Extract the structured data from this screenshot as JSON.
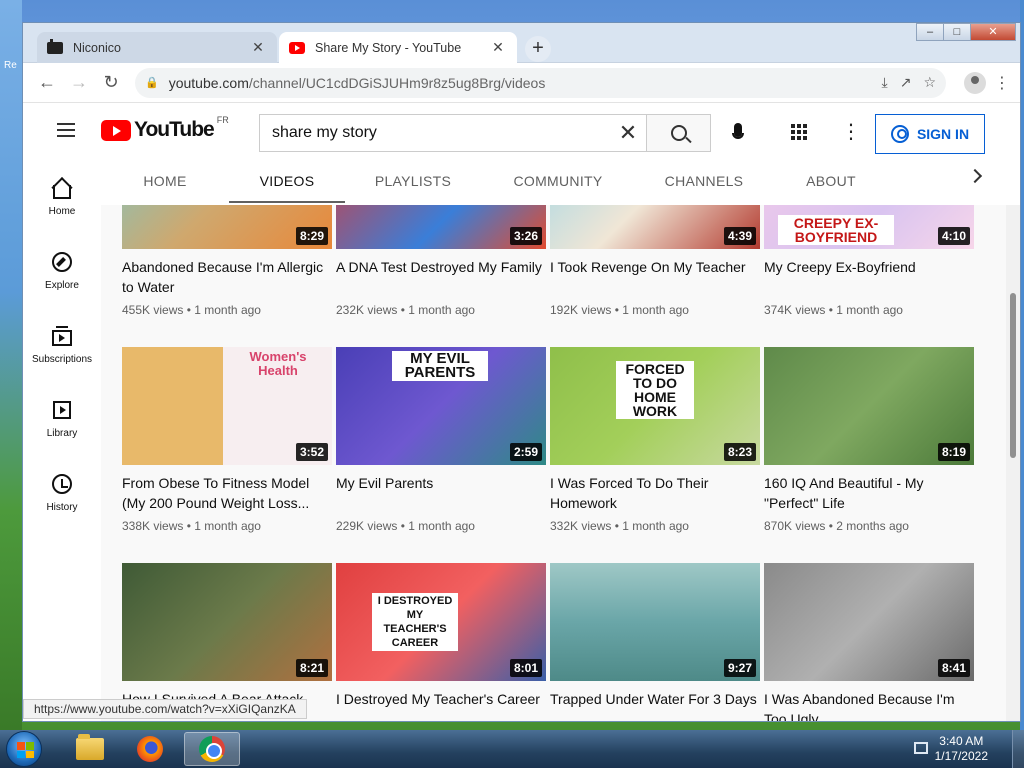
{
  "desktop": {
    "left_label": "Re"
  },
  "browser": {
    "tabs": [
      {
        "title": "Niconico",
        "close": "✕"
      },
      {
        "title": "Share My Story - YouTube",
        "close": "✕"
      }
    ],
    "new_tab": "+",
    "window_buttons": {
      "minimize": "–",
      "maximize": "□",
      "close": "✕"
    },
    "address": {
      "host": "youtube.com",
      "path": "/channel/UC1cdDGiSJUHm9r8z5ug8Brg/videos"
    },
    "status_url": "https://www.youtube.com/watch?v=xXiGIQanzKA"
  },
  "youtube": {
    "logo_text": "YouTube",
    "country_code": "FR",
    "search_value": "share my story",
    "sign_in": "SIGN IN",
    "guide": [
      {
        "label": "Home",
        "icon": "home-icon"
      },
      {
        "label": "Explore",
        "icon": "compass-icon"
      },
      {
        "label": "Subscriptions",
        "icon": "subscriptions-icon"
      },
      {
        "label": "Library",
        "icon": "library-icon"
      },
      {
        "label": "History",
        "icon": "history-icon"
      }
    ],
    "channel_tabs": [
      "HOME",
      "VIDEOS",
      "PLAYLISTS",
      "COMMUNITY",
      "CHANNELS",
      "ABOUT"
    ],
    "active_tab": "VIDEOS",
    "videos": [
      {
        "title": "Abandoned Because I'm Allergic to Water",
        "views": "455K views",
        "age": "1 month ago",
        "duration": "8:29"
      },
      {
        "title": "A DNA Test Destroyed My Family",
        "views": "232K views",
        "age": "1 month ago",
        "duration": "3:26"
      },
      {
        "title": "I Took Revenge On My Teacher",
        "views": "192K views",
        "age": "1 month ago",
        "duration": "4:39"
      },
      {
        "title": "My Creepy Ex-Boyfriend",
        "views": "374K views",
        "age": "1 month ago",
        "duration": "4:10",
        "thumb_text": "CREEPY EX-BOYFRIEND"
      },
      {
        "title": "From Obese To Fitness Model (My 200 Pound Weight Loss...",
        "views": "338K views",
        "age": "1 month ago",
        "duration": "3:52",
        "thumb_text": "Women's Health"
      },
      {
        "title": "My Evil Parents",
        "views": "229K views",
        "age": "1 month ago",
        "duration": "2:59",
        "thumb_text": "MY EVIL PARENTS"
      },
      {
        "title": "I Was Forced To Do Their Homework",
        "views": "332K views",
        "age": "1 month ago",
        "duration": "8:23",
        "thumb_text": "FORCED TO DO HOME WORK"
      },
      {
        "title": "160 IQ And Beautiful - My \"Perfect\" Life",
        "views": "870K views",
        "age": "2 months ago",
        "duration": "8:19"
      },
      {
        "title": "How I Survived A Bear Attack",
        "views": "",
        "age": "",
        "duration": "8:21"
      },
      {
        "title": "I Destroyed My Teacher's Career",
        "views": "",
        "age": "",
        "duration": "8:01",
        "thumb_text": "I DESTROYED MY TEACHER'S CAREER"
      },
      {
        "title": "Trapped Under Water For 3 Days",
        "views": "",
        "age": "",
        "duration": "9:27"
      },
      {
        "title": "I Was Abandoned Because I'm Too Ugly",
        "views": "",
        "age": "",
        "duration": "8:41"
      }
    ]
  },
  "taskbar": {
    "time": "3:40 AM",
    "date": "1/17/2022"
  }
}
